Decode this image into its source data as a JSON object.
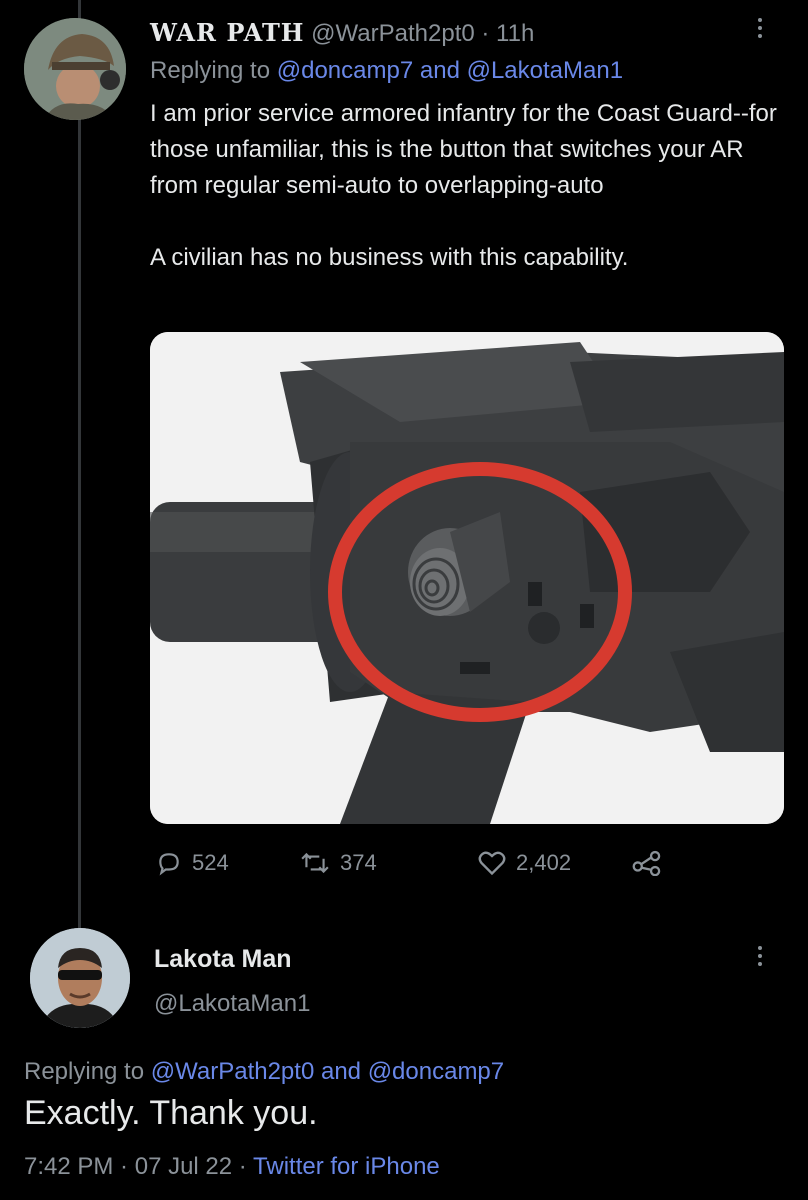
{
  "tweet1": {
    "display_name": "WAR PATH",
    "handle": "@WarPath2pt0",
    "separator": " · ",
    "time": "11h",
    "replying_prefix": "Replying to ",
    "replying_to_1": "@doncamp7",
    "replying_and": " and ",
    "replying_to_2": "@LakotaMan1",
    "body_paragraph_1": "I am prior service armored infantry for the Coast Guard--for those unfamiliar, this is the button that switches your AR from regular semi-auto to overlapping-auto",
    "body_paragraph_2": "A civilian has no business with this capability.",
    "stats": {
      "replies": "524",
      "retweets": "374",
      "likes": "2,402"
    }
  },
  "tweet2": {
    "display_name": "Lakota Man",
    "handle": "@LakotaMan1",
    "replying_prefix": "Replying to ",
    "replying_to_1": "@WarPath2pt0",
    "replying_and": " and ",
    "replying_to_2": "@doncamp7",
    "body": "Exactly. Thank you.",
    "time": "7:42 PM",
    "separator_1": " · ",
    "date": "07 Jul 22",
    "separator_2": " · ",
    "source": "Twitter for iPhone"
  },
  "colors": {
    "background": "#000000",
    "text": "#e7e9ea",
    "muted": "#8b9299",
    "link": "#6a88e8",
    "highlight_circle": "#d63a2f"
  },
  "icons": [
    "more-icon",
    "reply-icon",
    "retweet-icon",
    "like-icon",
    "share-icon"
  ]
}
